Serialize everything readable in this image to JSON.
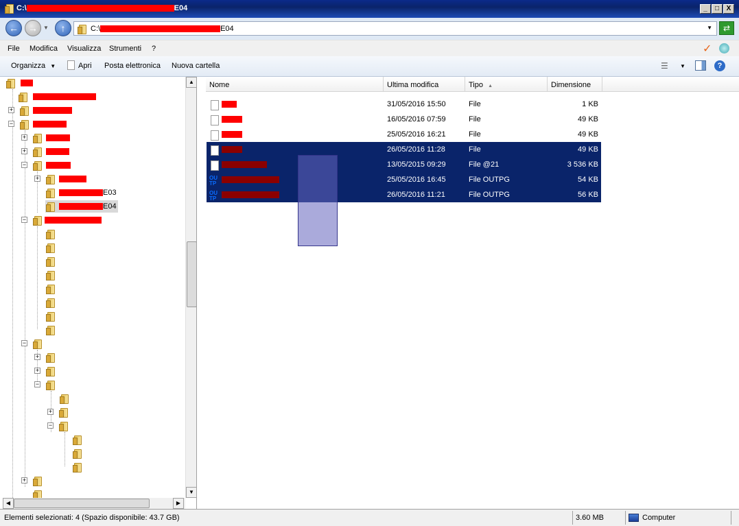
{
  "window": {
    "title_prefix": "C:\\",
    "title_suffix": "E04",
    "minimize": "_",
    "maximize": "□",
    "close": "X"
  },
  "address": {
    "path_prefix": "C:\\",
    "path_suffix": "E04"
  },
  "menu": {
    "items": [
      "File",
      "Modifica",
      "Visualizza",
      "Strumenti",
      "?"
    ]
  },
  "toolbar": {
    "organize": "Organizza",
    "open": "Apri",
    "email": "Posta elettronica",
    "new_folder": "Nuova cartella"
  },
  "tree": {
    "e03_suffix": "E03",
    "e04_suffix": "E04"
  },
  "columns": {
    "name": "Nome",
    "modified": "Ultima modifica",
    "type": "Tipo",
    "size": "Dimensione"
  },
  "files": [
    {
      "date": "31/05/2016 15:50",
      "type": "File",
      "size": "1 KB",
      "selected": false,
      "icon": "file-icon"
    },
    {
      "date": "16/05/2016 07:59",
      "type": "File",
      "size": "49 KB",
      "selected": false,
      "icon": "file-icon"
    },
    {
      "date": "25/05/2016 16:21",
      "type": "File",
      "size": "49 KB",
      "selected": false,
      "icon": "file-icon"
    },
    {
      "date": "26/05/2016 11:28",
      "type": "File",
      "size": "49 KB",
      "selected": true,
      "icon": "file-icon"
    },
    {
      "date": "13/05/2015 09:29",
      "type": "File @21",
      "size": "3 536 KB",
      "selected": true,
      "icon": "file-icon"
    },
    {
      "date": "25/05/2016 16:45",
      "type": "File OUTPG",
      "size": "54 KB",
      "selected": true,
      "icon": "outp-icon"
    },
    {
      "date": "26/05/2016 11:21",
      "type": "File OUTPG",
      "size": "56 KB",
      "selected": true,
      "icon": "outp-icon"
    }
  ],
  "outp_label": "OU\nTP",
  "status": {
    "selection": "Elementi selezionati: 4 (Spazio disponibile: 43.7 GB)",
    "size": "3.60 MB",
    "location": "Computer"
  },
  "colors": {
    "selection": "#0a246a",
    "redaction": "#ff0000"
  }
}
